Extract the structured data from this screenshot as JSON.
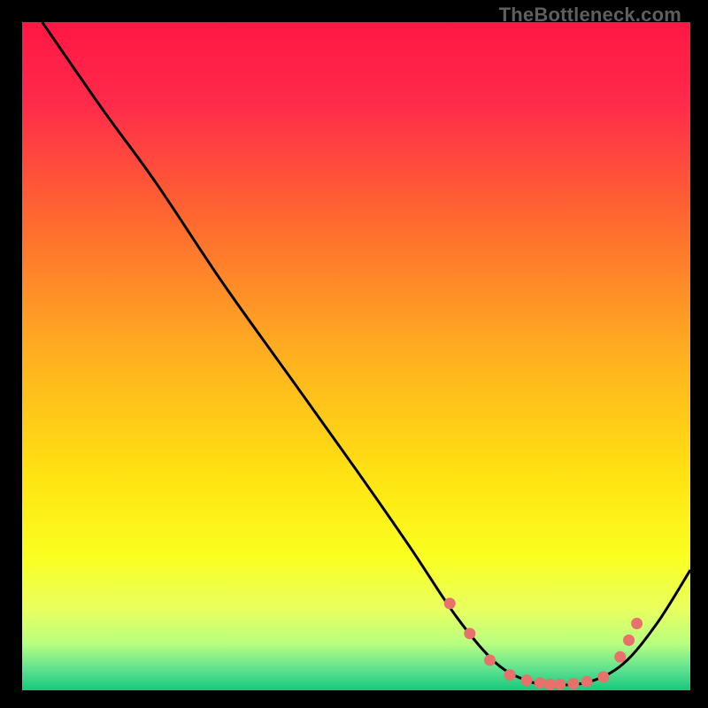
{
  "watermark": "TheBottleneck.com",
  "chart_data": {
    "type": "line",
    "title": "",
    "xlabel": "",
    "ylabel": "",
    "xlim": [
      0,
      100
    ],
    "ylim": [
      0,
      100
    ],
    "grid": false,
    "curve_points": [
      {
        "x": 3.0,
        "y": 100.0
      },
      {
        "x": 12.0,
        "y": 87.0
      },
      {
        "x": 20.0,
        "y": 76.0
      },
      {
        "x": 30.0,
        "y": 61.0
      },
      {
        "x": 40.0,
        "y": 47.0
      },
      {
        "x": 50.0,
        "y": 33.0
      },
      {
        "x": 58.0,
        "y": 21.5
      },
      {
        "x": 65.0,
        "y": 11.0
      },
      {
        "x": 71.0,
        "y": 4.0
      },
      {
        "x": 76.0,
        "y": 1.3
      },
      {
        "x": 80.0,
        "y": 0.8
      },
      {
        "x": 85.0,
        "y": 1.3
      },
      {
        "x": 90.0,
        "y": 4.0
      },
      {
        "x": 95.0,
        "y": 10.0
      },
      {
        "x": 100.0,
        "y": 18.0
      }
    ],
    "markers": [
      {
        "x": 64.0,
        "y": 13.0
      },
      {
        "x": 67.0,
        "y": 8.5
      },
      {
        "x": 70.0,
        "y": 4.5
      },
      {
        "x": 73.0,
        "y": 2.3
      },
      {
        "x": 75.5,
        "y": 1.5
      },
      {
        "x": 77.5,
        "y": 1.1
      },
      {
        "x": 79.0,
        "y": 0.9
      },
      {
        "x": 80.5,
        "y": 0.9
      },
      {
        "x": 82.5,
        "y": 1.0
      },
      {
        "x": 84.5,
        "y": 1.3
      },
      {
        "x": 87.0,
        "y": 2.0
      },
      {
        "x": 89.5,
        "y": 5.0
      },
      {
        "x": 90.8,
        "y": 7.5
      },
      {
        "x": 92.0,
        "y": 10.0
      }
    ],
    "gradient_stops": [
      {
        "offset": 0.0,
        "color": "#ff1744"
      },
      {
        "offset": 0.12,
        "color": "#ff2a4a"
      },
      {
        "offset": 0.3,
        "color": "#ff6a2f"
      },
      {
        "offset": 0.5,
        "color": "#ffb020"
      },
      {
        "offset": 0.68,
        "color": "#ffe312"
      },
      {
        "offset": 0.8,
        "color": "#faff20"
      },
      {
        "offset": 0.88,
        "color": "#e8ff60"
      },
      {
        "offset": 0.93,
        "color": "#b8ff80"
      },
      {
        "offset": 0.97,
        "color": "#5be090"
      },
      {
        "offset": 1.0,
        "color": "#16c97a"
      }
    ],
    "marker_color": "#e9716b",
    "curve_color": "#000000"
  }
}
